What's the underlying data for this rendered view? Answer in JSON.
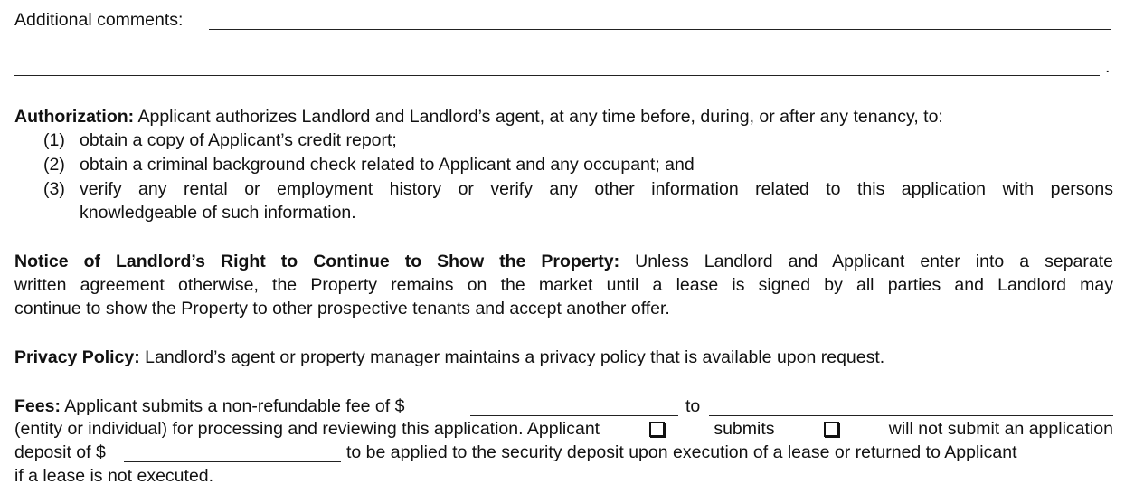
{
  "comments": {
    "label": "Additional comments:",
    "end_mark": "."
  },
  "authorization": {
    "heading": "Authorization:",
    "intro": "Applicant authorizes Landlord and Landlord’s agent, at any time before, during, or after any tenancy, to:",
    "items": [
      {
        "num": "(1)",
        "text": "obtain a copy of Applicant’s credit report;"
      },
      {
        "num": "(2)",
        "text": "obtain a criminal background check related to Applicant and any occupant; and"
      },
      {
        "num": "(3)",
        "text": "verify any rental or employment history or verify any other information related to this application with persons",
        "text2": "knowledgeable of such information."
      }
    ]
  },
  "notice": {
    "heading": "Notice of Landlord’s Right to Continue to Show the Property:",
    "line1": "Unless Landlord and Applicant enter into a separate",
    "line2": "written agreement otherwise, the Property remains on the market until a lease is signed by all parties and Landlord may",
    "line3": "continue to show the Property to other prospective tenants and accept another offer."
  },
  "privacy": {
    "heading": "Privacy Policy:",
    "text": "Landlord’s agent or property manager maintains a privacy policy that is available upon request."
  },
  "fees": {
    "heading": "Fees:",
    "text1": "Applicant submits a non-refundable fee of $",
    "to": "to",
    "line2a": "(entity or individual) for processing and reviewing this application.  Applicant",
    "submits": "submits",
    "will_not": "will not submit an application",
    "deposit_label": "deposit of $",
    "line3b": "to be applied to the security deposit upon execution of a lease or returned to Applicant",
    "line4": "if a lease is not executed."
  }
}
